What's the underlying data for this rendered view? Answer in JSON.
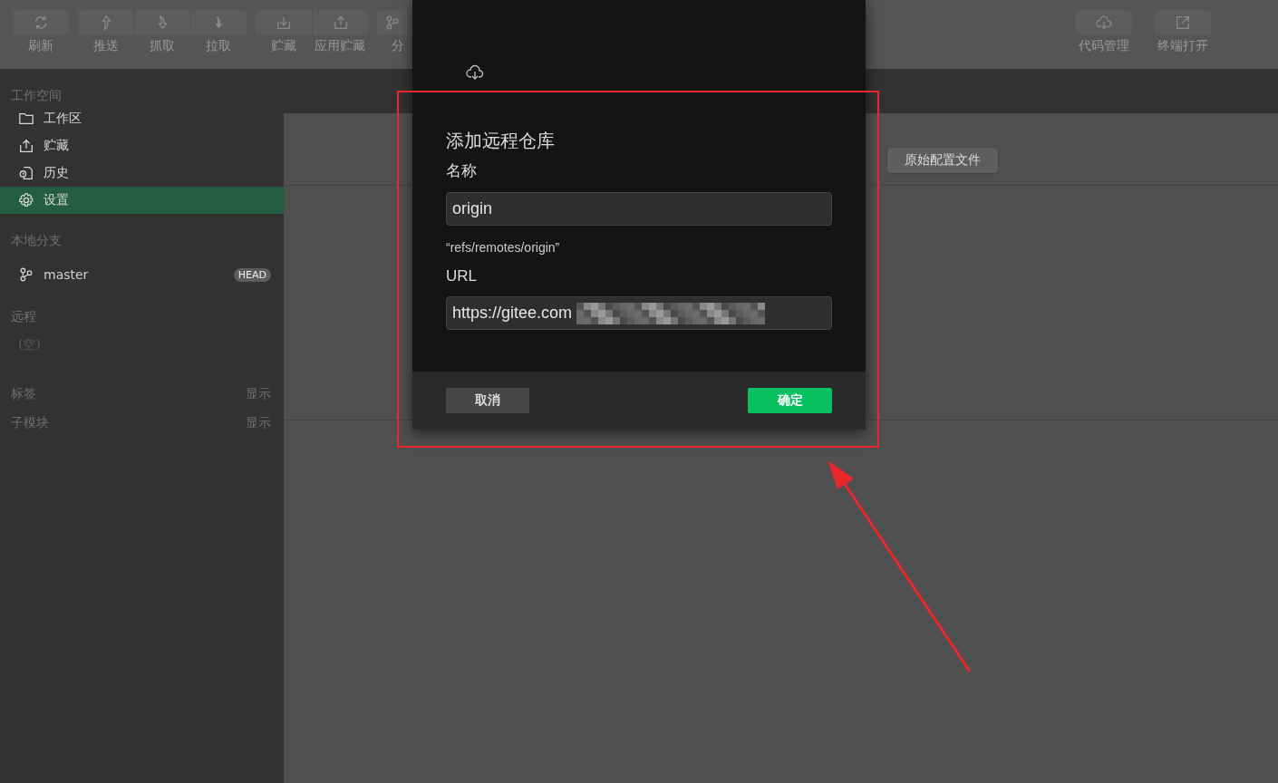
{
  "toolbar": {
    "groups": [
      [
        {
          "label": "刷新"
        }
      ],
      [
        {
          "label": "推送"
        },
        {
          "label": "抓取"
        },
        {
          "label": "拉取"
        }
      ],
      [
        {
          "label": "贮藏"
        },
        {
          "label": "应用贮藏"
        }
      ],
      [
        {
          "label": "分"
        }
      ]
    ],
    "right": [
      {
        "label": "代码管理"
      },
      {
        "label": "终端打开"
      }
    ]
  },
  "sidebar": {
    "sections": [
      {
        "title": "工作空间",
        "items": [
          {
            "kind": "nav",
            "label": "工作区",
            "selected": false
          },
          {
            "kind": "nav",
            "label": "贮藏",
            "selected": false
          },
          {
            "kind": "nav",
            "label": "历史",
            "selected": false
          },
          {
            "kind": "nav",
            "label": "设置",
            "selected": true
          }
        ]
      },
      {
        "title": "本地分支",
        "items": [
          {
            "kind": "branch",
            "label": "master",
            "badge": "HEAD"
          }
        ]
      },
      {
        "title": "远程",
        "items": [
          {
            "kind": "empty",
            "label": "(空)"
          }
        ]
      },
      {
        "title": "标签",
        "action": "显示"
      },
      {
        "title": "子模块",
        "action": "显示"
      }
    ]
  },
  "main": {
    "button": "原始配置文件"
  },
  "dialog": {
    "title": "添加远程仓库",
    "name_label": "名称",
    "name_value": "origin",
    "hint": "“refs/remotes/origin”",
    "url_label": "URL",
    "url_value": "https://gitee.com",
    "cancel": "取消",
    "confirm": "确定"
  }
}
